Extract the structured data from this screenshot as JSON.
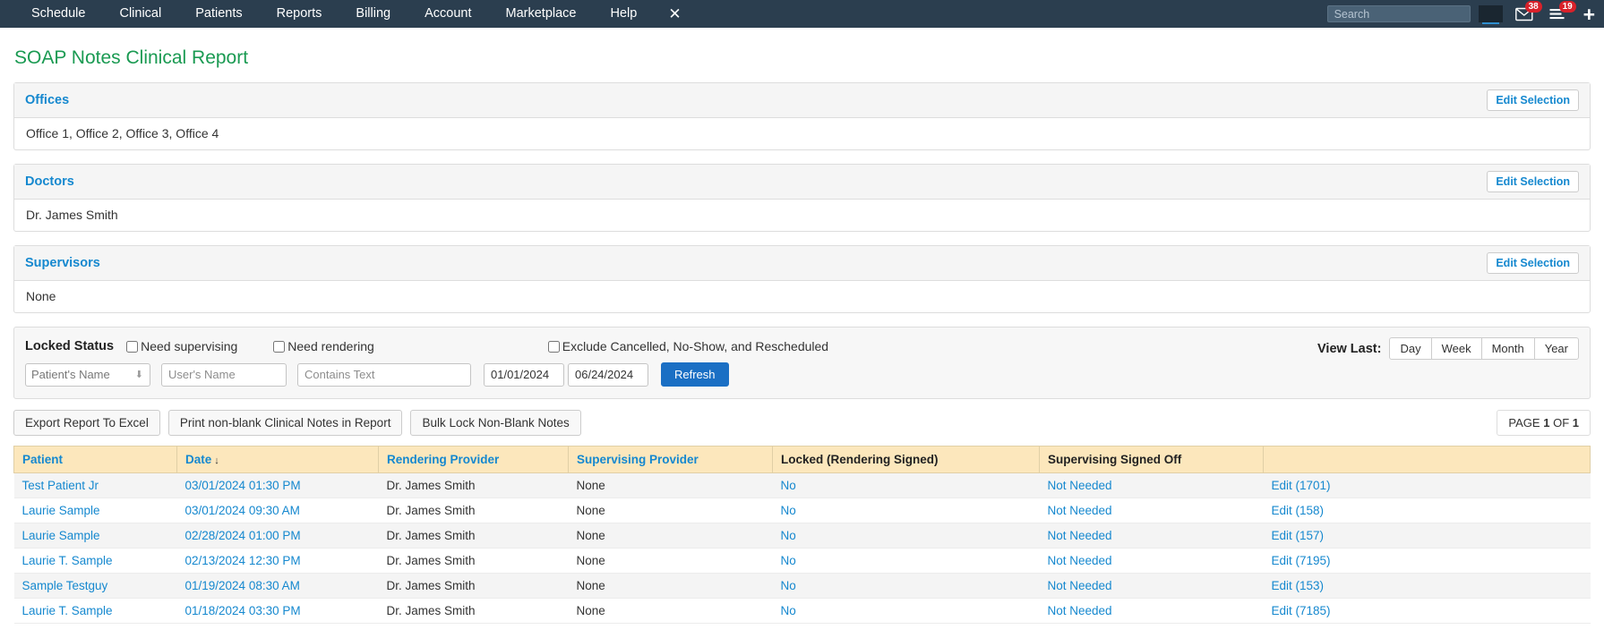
{
  "navbar": {
    "links": [
      "Schedule",
      "Clinical",
      "Patients",
      "Reports",
      "Billing",
      "Account",
      "Marketplace",
      "Help"
    ],
    "close_label": "✕",
    "search_placeholder": "Search",
    "search_value": "",
    "mail_badge": "38",
    "list_badge": "19",
    "plus_label": "+"
  },
  "page": {
    "title": "SOAP Notes Clinical Report"
  },
  "panels": [
    {
      "title": "Offices",
      "value": "Office 1, Office 2, Office 3, Office 4",
      "button": "Edit Selection"
    },
    {
      "title": "Doctors",
      "value": "Dr. James Smith",
      "button": "Edit Selection"
    },
    {
      "title": "Supervisors",
      "value": "None",
      "button": "Edit Selection"
    }
  ],
  "filters": {
    "locked_status_label": "Locked Status",
    "need_supervising": "Need supervising",
    "need_rendering": "Need rendering",
    "exclude": "Exclude Cancelled, No-Show, and Rescheduled",
    "view_last_label": "View Last:",
    "view_last_options": [
      "Day",
      "Week",
      "Month",
      "Year"
    ],
    "patient_select": "Patient's Name",
    "user_name_placeholder": "User's Name",
    "user_name_value": "",
    "contains_text_placeholder": "Contains Text",
    "contains_text_value": "",
    "date_from": "01/01/2024",
    "date_to": "06/24/2024",
    "refresh_label": "Refresh"
  },
  "actions": {
    "export": "Export Report To Excel",
    "print": "Print non-blank Clinical Notes in Report",
    "bulk_lock": "Bulk Lock Non-Blank Notes",
    "page_prefix": "PAGE",
    "page_current": "1",
    "page_of": "OF",
    "page_total": "1"
  },
  "table": {
    "headers": [
      {
        "label": "Patient",
        "link": true,
        "sorted": false
      },
      {
        "label": "Date",
        "link": true,
        "sorted": true,
        "sort_dir": "↓"
      },
      {
        "label": "Rendering Provider",
        "link": true,
        "sorted": false
      },
      {
        "label": "Supervising Provider",
        "link": true,
        "sorted": false
      },
      {
        "label": "Locked (Rendering Signed)",
        "link": false,
        "sorted": false
      },
      {
        "label": "Supervising Signed Off",
        "link": false,
        "sorted": false
      },
      {
        "label": "",
        "link": false,
        "sorted": false
      }
    ],
    "rows": [
      {
        "patient": "Test Patient Jr",
        "date": "03/01/2024 01:30 PM",
        "rendering": "Dr. James Smith",
        "supervising": "None",
        "locked": "No",
        "signed_off": "Not Needed",
        "edit": "Edit (1701)"
      },
      {
        "patient": "Laurie Sample",
        "date": "03/01/2024 09:30 AM",
        "rendering": "Dr. James Smith",
        "supervising": "None",
        "locked": "No",
        "signed_off": "Not Needed",
        "edit": "Edit (158)"
      },
      {
        "patient": "Laurie Sample",
        "date": "02/28/2024 01:00 PM",
        "rendering": "Dr. James Smith",
        "supervising": "None",
        "locked": "No",
        "signed_off": "Not Needed",
        "edit": "Edit (157)"
      },
      {
        "patient": "Laurie T. Sample",
        "date": "02/13/2024 12:30 PM",
        "rendering": "Dr. James Smith",
        "supervising": "None",
        "locked": "No",
        "signed_off": "Not Needed",
        "edit": "Edit (7195)"
      },
      {
        "patient": "Sample Testguy",
        "date": "01/19/2024 08:30 AM",
        "rendering": "Dr. James Smith",
        "supervising": "None",
        "locked": "No",
        "signed_off": "Not Needed",
        "edit": "Edit (153)"
      },
      {
        "patient": "Laurie T. Sample",
        "date": "01/18/2024 03:30 PM",
        "rendering": "Dr. James Smith",
        "supervising": "None",
        "locked": "No",
        "signed_off": "Not Needed",
        "edit": "Edit (7185)"
      }
    ]
  },
  "colors": {
    "navbar_bg": "#2b3e4f",
    "title_green": "#1a9a52",
    "link_blue": "#1588cf",
    "badge_red": "#d9212a",
    "table_header_bg": "#fce7bc",
    "refresh_blue": "#1a6fc4"
  }
}
